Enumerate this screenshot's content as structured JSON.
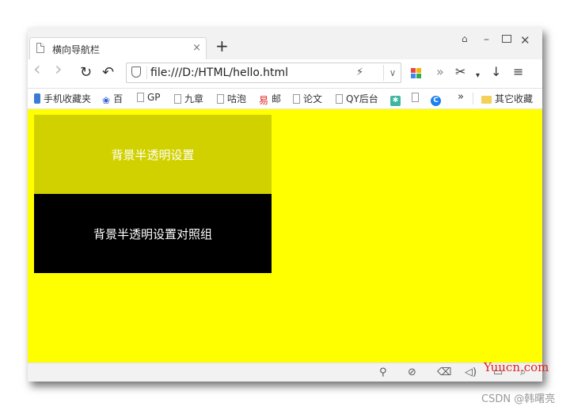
{
  "browser": {
    "tab_title": "横向导航栏",
    "tab_close": "×",
    "new_tab": "+",
    "window_controls": {
      "shirt": "👕",
      "minimize": "–",
      "close": "✕"
    },
    "nav": {
      "back": "‹",
      "forward": "›",
      "reload": "↻",
      "undo": "↶"
    },
    "url": "file:///D:/HTML/hello.html",
    "url_icons": {
      "bolt": "⚡",
      "leaf": "ꝭ",
      "dropdown": "∨"
    },
    "toolbar_icons": {
      "more": "»",
      "scissors": "✂",
      "caret": "▾",
      "download": "↓",
      "menu": "≡"
    },
    "bookmarks": [
      {
        "label": "手机收藏夹",
        "icon": "phone-icon"
      },
      {
        "label": "百",
        "icon": "paw-icon"
      },
      {
        "label": "GP",
        "icon": "page-icon"
      },
      {
        "label": "九章",
        "icon": "page-icon"
      },
      {
        "label": "咕泡",
        "icon": "page-icon"
      },
      {
        "label": "邮",
        "icon": "mail-icon"
      },
      {
        "label": "论文",
        "icon": "page-icon"
      },
      {
        "label": "QY后台",
        "icon": "page-icon"
      },
      {
        "label": "",
        "icon": "gear-icon"
      },
      {
        "label": "",
        "icon": "page-icon"
      },
      {
        "label": "",
        "icon": "g-icon"
      }
    ],
    "bookmarks_more": "»",
    "other_bookmarks": "其它收藏"
  },
  "page": {
    "background": "#ffff00",
    "box_semi_text": "背景半透明设置",
    "box_solid_text": "背景半透明设置对照组"
  },
  "statusbar": {
    "pin": "📌",
    "compass": "⊘",
    "trash": "🗑",
    "speaker": "🔈",
    "window": "▭",
    "search": "🔍"
  },
  "watermarks": {
    "site": "Yuucn.com",
    "csdn": "CSDN @韩曙亮"
  }
}
